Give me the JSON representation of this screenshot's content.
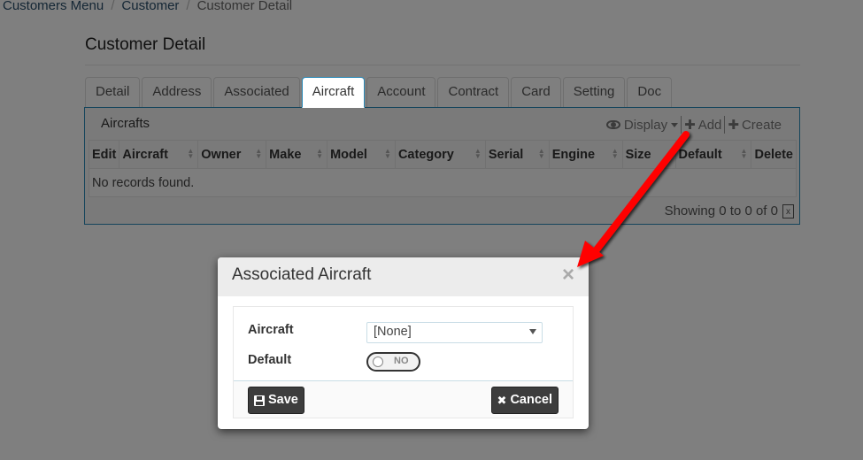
{
  "breadcrumb": [
    "Customers Menu",
    "Customer",
    "Customer Detail"
  ],
  "page_title": "Customer Detail",
  "tabs": [
    {
      "label": "Detail",
      "active": false
    },
    {
      "label": "Address",
      "active": false
    },
    {
      "label": "Associated",
      "active": false
    },
    {
      "label": "Aircraft",
      "active": true
    },
    {
      "label": "Account",
      "active": false
    },
    {
      "label": "Contract",
      "active": false
    },
    {
      "label": "Card",
      "active": false
    },
    {
      "label": "Setting",
      "active": false
    },
    {
      "label": "Doc",
      "active": false
    }
  ],
  "panel": {
    "title": "Aircrafts",
    "toolbar": {
      "display_label": "Display",
      "add_label": "Add",
      "create_label": "Create",
      "display_icon": "eye-icon",
      "add_icon": "plus-icon",
      "create_icon": "plus-icon"
    },
    "columns": [
      {
        "label": "Edit",
        "sortable": false
      },
      {
        "label": "Aircraft",
        "sortable": true
      },
      {
        "label": "Owner",
        "sortable": true
      },
      {
        "label": "Make",
        "sortable": true
      },
      {
        "label": "Model",
        "sortable": true
      },
      {
        "label": "Category",
        "sortable": true
      },
      {
        "label": "Serial",
        "sortable": true
      },
      {
        "label": "Engine",
        "sortable": true
      },
      {
        "label": "Size",
        "sortable": false
      },
      {
        "label": "Default",
        "sortable": true
      },
      {
        "label": "Delete",
        "sortable": false
      }
    ],
    "empty_message": "No records found.",
    "footer": "Showing 0 to 0 of 0",
    "export_icon": "excel-export-icon"
  },
  "modal": {
    "title": "Associated Aircraft",
    "close_glyph": "×",
    "fields": {
      "aircraft_label": "Aircraft",
      "aircraft_value": "[None]",
      "default_label": "Default",
      "default_toggle": "NO"
    },
    "save_label": "Save",
    "cancel_label": "Cancel"
  },
  "annotation": {
    "type": "arrow",
    "color": "#ff0000",
    "points_from": "Add button",
    "points_to": "modal close button"
  },
  "colors": {
    "accent": "#2a8ab8",
    "overlay": "rgba(0,0,0,0.5)",
    "button_dark": "#3d3d3d"
  }
}
